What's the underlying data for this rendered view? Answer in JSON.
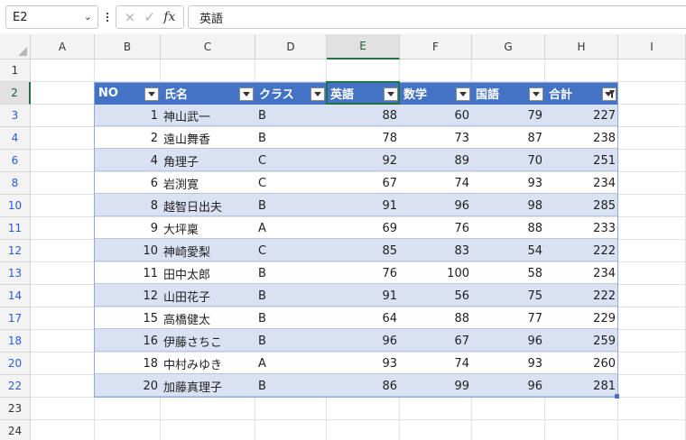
{
  "formula_bar": {
    "name_box": "E2",
    "cancel_icon": "×",
    "enter_icon": "✓",
    "fx_label": "fx",
    "content": "英語"
  },
  "columns": [
    "A",
    "B",
    "C",
    "D",
    "E",
    "F",
    "G",
    "H",
    "I"
  ],
  "selected_column": "E",
  "rows": [
    "1",
    "2",
    "3",
    "4",
    "6",
    "8",
    "10",
    "11",
    "12",
    "13",
    "14",
    "17",
    "18",
    "20",
    "22",
    "23",
    "24"
  ],
  "selected_row": "2",
  "table": {
    "headers": [
      "NO",
      "氏名",
      "クラス",
      "英語",
      "数学",
      "国語",
      "合計"
    ],
    "filtered_column": "合計",
    "rows": [
      {
        "no": "1",
        "name": "神山武一",
        "class": "B",
        "english": "88",
        "math": "60",
        "japanese": "79",
        "total": "227"
      },
      {
        "no": "2",
        "name": "遠山舞香",
        "class": "B",
        "english": "78",
        "math": "73",
        "japanese": "87",
        "total": "238"
      },
      {
        "no": "4",
        "name": "角理子",
        "class": "C",
        "english": "92",
        "math": "89",
        "japanese": "70",
        "total": "251"
      },
      {
        "no": "6",
        "name": "岩渕寛",
        "class": "C",
        "english": "67",
        "math": "74",
        "japanese": "93",
        "total": "234"
      },
      {
        "no": "8",
        "name": "越智日出夫",
        "class": "B",
        "english": "91",
        "math": "96",
        "japanese": "98",
        "total": "285"
      },
      {
        "no": "9",
        "name": "大坪稟",
        "class": "A",
        "english": "69",
        "math": "76",
        "japanese": "88",
        "total": "233"
      },
      {
        "no": "10",
        "name": "神崎愛梨",
        "class": "C",
        "english": "85",
        "math": "83",
        "japanese": "54",
        "total": "222"
      },
      {
        "no": "11",
        "name": "田中太郎",
        "class": "B",
        "english": "76",
        "math": "100",
        "japanese": "58",
        "total": "234"
      },
      {
        "no": "12",
        "name": "山田花子",
        "class": "B",
        "english": "91",
        "math": "56",
        "japanese": "75",
        "total": "222"
      },
      {
        "no": "15",
        "name": "高橋健太",
        "class": "B",
        "english": "64",
        "math": "88",
        "japanese": "77",
        "total": "229"
      },
      {
        "no": "16",
        "name": "伊藤さちこ",
        "class": "B",
        "english": "96",
        "math": "67",
        "japanese": "96",
        "total": "259"
      },
      {
        "no": "18",
        "name": "中村みゆき",
        "class": "A",
        "english": "93",
        "math": "74",
        "japanese": "93",
        "total": "260"
      },
      {
        "no": "20",
        "name": "加藤真理子",
        "class": "B",
        "english": "86",
        "math": "99",
        "japanese": "96",
        "total": "281"
      }
    ]
  },
  "colors": {
    "table_header": "#4472c4",
    "band_row": "#d9e1f2",
    "selection": "#217346",
    "filtered_row_number": "#2a5bd7"
  }
}
